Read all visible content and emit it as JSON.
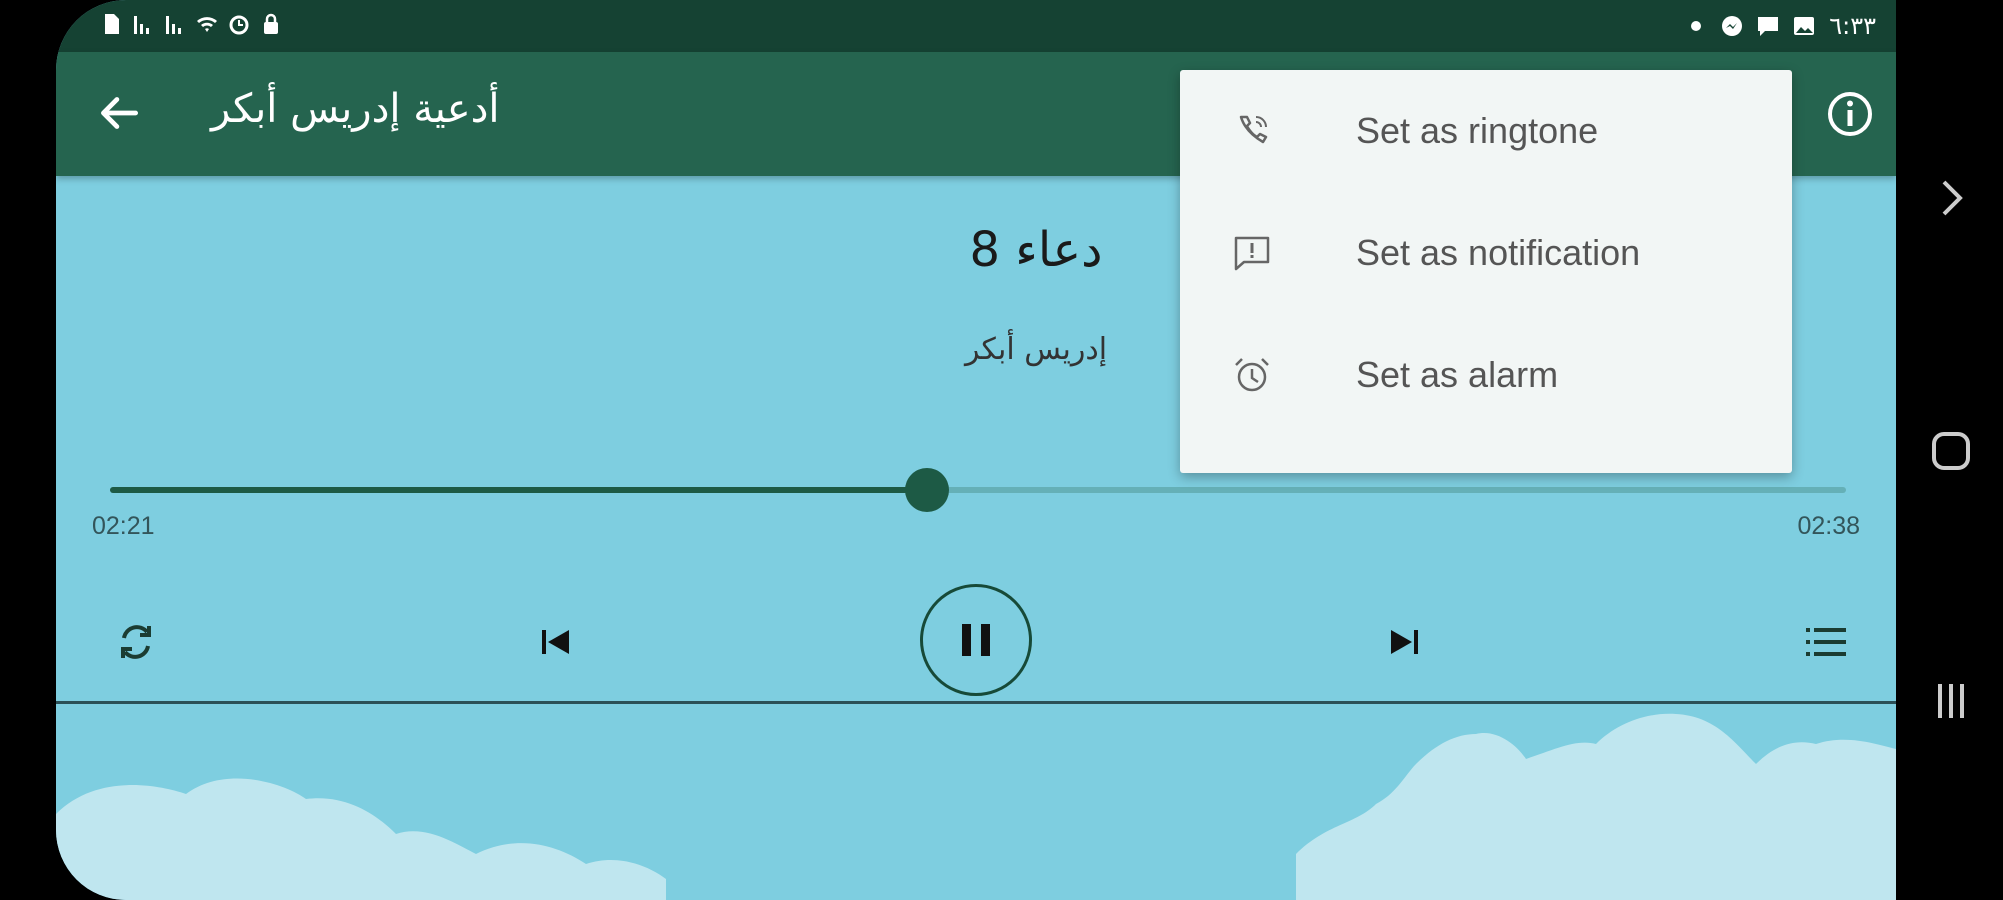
{
  "status_bar": {
    "time": "٦:٣٣",
    "left_icons": [
      "sim-icon",
      "signal-icon",
      "signal-icon",
      "wifi-icon",
      "alarm-icon",
      "lock-icon"
    ],
    "right_icons": [
      "dot-icon",
      "messenger-icon",
      "chat-icon",
      "image-icon"
    ]
  },
  "app_bar": {
    "title": "أدعية إدريس أبكر"
  },
  "player": {
    "track_title": "دعاء 8",
    "artist": "إدريس أبكر",
    "elapsed": "02:21",
    "total": "02:38",
    "progress": 0.4705
  },
  "menu": {
    "items": [
      {
        "label": "Set as ringtone",
        "icon": "phone-ring-icon"
      },
      {
        "label": "Set as notification",
        "icon": "notification-icon"
      },
      {
        "label": "Set as alarm",
        "icon": "alarm-clock-icon"
      }
    ]
  },
  "colors": {
    "app_bar": "#25644f",
    "status_bar": "#154233",
    "background": "#7ecee0",
    "accent": "#1d5a45",
    "cloud": "#bfe6ef"
  }
}
